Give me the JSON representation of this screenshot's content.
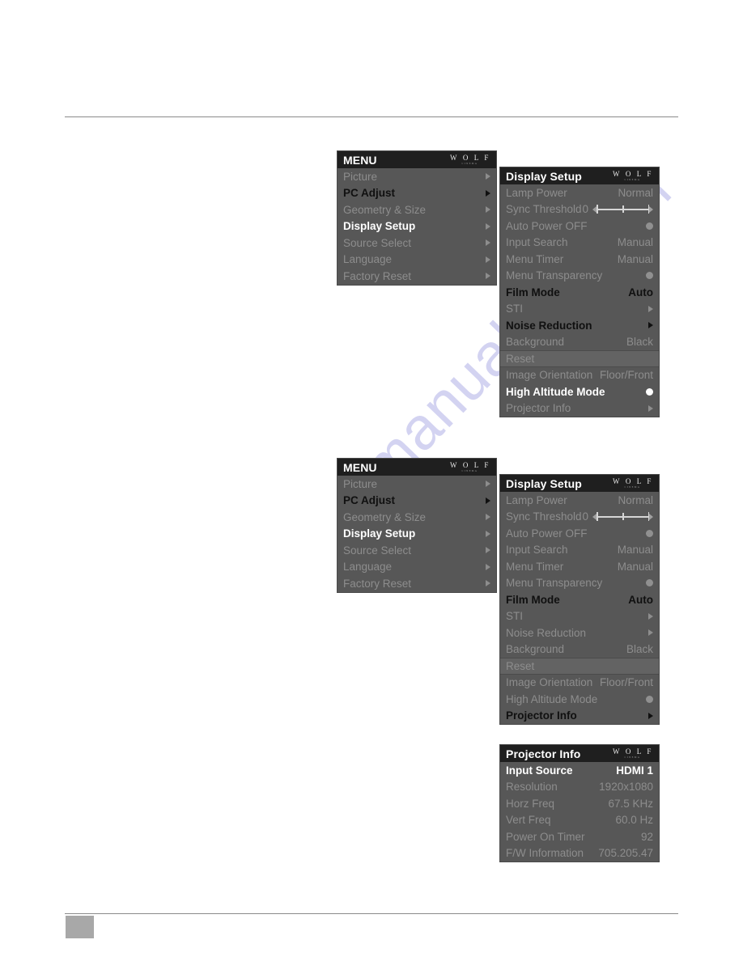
{
  "logo": {
    "main": "W O L F",
    "sub": "CINEMA"
  },
  "menu_panel": {
    "title": "MENU",
    "items": [
      {
        "label": "Picture",
        "state": "dim",
        "arrow": "dim"
      },
      {
        "label": "PC Adjust",
        "state": "dark",
        "arrow": "dark"
      },
      {
        "label": "Geometry & Size",
        "state": "dim",
        "arrow": "dim"
      },
      {
        "label": "Display Setup",
        "state": "white",
        "arrow": "light"
      },
      {
        "label": "Source Select",
        "state": "dim",
        "arrow": "dim"
      },
      {
        "label": "Language",
        "state": "dim",
        "arrow": "dim"
      },
      {
        "label": "Factory Reset",
        "state": "dim",
        "arrow": "dim"
      }
    ]
  },
  "display_setup_1": {
    "title": "Display Setup",
    "items": [
      {
        "label": "Lamp Power",
        "value": "Normal",
        "type": "text",
        "state": "dim"
      },
      {
        "label": "Sync Threshold",
        "value": "0",
        "type": "slider",
        "state": "dim"
      },
      {
        "label": "Auto Power OFF",
        "value": "",
        "type": "bullet",
        "state": "dim"
      },
      {
        "label": "Input Search",
        "value": "Manual",
        "type": "text",
        "state": "dim"
      },
      {
        "label": "Menu Timer",
        "value": "Manual",
        "type": "text",
        "state": "dim"
      },
      {
        "label": "Menu Transparency",
        "value": "",
        "type": "bullet",
        "state": "dim"
      },
      {
        "label": "Film Mode",
        "value": "Auto",
        "type": "text",
        "state": "dark"
      },
      {
        "label": "STI",
        "value": "",
        "type": "arrow",
        "state": "dim"
      },
      {
        "label": "Noise Reduction",
        "value": "",
        "type": "arrow",
        "state": "dark"
      },
      {
        "label": "Background",
        "value": "Black",
        "type": "text",
        "state": "dim"
      },
      {
        "label": "Reset",
        "value": "",
        "type": "none",
        "state": "band"
      },
      {
        "label": "Image Orientation",
        "value": "Floor/Front",
        "type": "text",
        "state": "dim"
      },
      {
        "label": "High Altitude Mode",
        "value": "",
        "type": "bullet_on",
        "state": "white"
      },
      {
        "label": "Projector Info",
        "value": "",
        "type": "arrow",
        "state": "dim"
      }
    ]
  },
  "display_setup_2": {
    "title": "Display Setup",
    "items": [
      {
        "label": "Lamp Power",
        "value": "Normal",
        "type": "text",
        "state": "dim"
      },
      {
        "label": "Sync Threshold",
        "value": "0",
        "type": "slider",
        "state": "dim"
      },
      {
        "label": "Auto Power OFF",
        "value": "",
        "type": "bullet",
        "state": "dim"
      },
      {
        "label": "Input Search",
        "value": "Manual",
        "type": "text",
        "state": "dim"
      },
      {
        "label": "Menu Timer",
        "value": "Manual",
        "type": "text",
        "state": "dim"
      },
      {
        "label": "Menu Transparency",
        "value": "",
        "type": "bullet",
        "state": "dim"
      },
      {
        "label": "Film Mode",
        "value": "Auto",
        "type": "text",
        "state": "dark"
      },
      {
        "label": "STI",
        "value": "",
        "type": "arrow",
        "state": "dim"
      },
      {
        "label": "Noise Reduction",
        "value": "",
        "type": "arrow",
        "state": "dim"
      },
      {
        "label": "Background",
        "value": "Black",
        "type": "text",
        "state": "dim"
      },
      {
        "label": "Reset",
        "value": "",
        "type": "none",
        "state": "band"
      },
      {
        "label": "Image Orientation",
        "value": "Floor/Front",
        "type": "text",
        "state": "dim"
      },
      {
        "label": "High Altitude Mode",
        "value": "",
        "type": "bullet",
        "state": "dim"
      },
      {
        "label": "Projector Info",
        "value": "",
        "type": "arrow",
        "state": "dark"
      }
    ]
  },
  "projector_info": {
    "title": "Projector Info",
    "items": [
      {
        "label": "Input Source",
        "value": "HDMI 1",
        "type": "text",
        "state": "white"
      },
      {
        "label": "Resolution",
        "value": "1920x1080",
        "type": "text",
        "state": "dim"
      },
      {
        "label": "Horz Freq",
        "value": "67.5 KHz",
        "type": "text",
        "state": "dim"
      },
      {
        "label": "Vert Freq",
        "value": "60.0 Hz",
        "type": "text",
        "state": "dim"
      },
      {
        "label": "Power On Timer",
        "value": "92",
        "type": "text",
        "state": "dim"
      },
      {
        "label": "F/W Information",
        "value": "705.205.47",
        "type": "text",
        "state": "dim"
      }
    ]
  },
  "watermark": {
    "text": "manualive.com"
  },
  "colors": {
    "panel_bg": "#575757",
    "title_bg": "#1f1f1f",
    "band_bg": "#636363",
    "dim_text": "#8d8d8d",
    "highlight_white": "#ffffff",
    "highlight_dark": "#101010"
  }
}
